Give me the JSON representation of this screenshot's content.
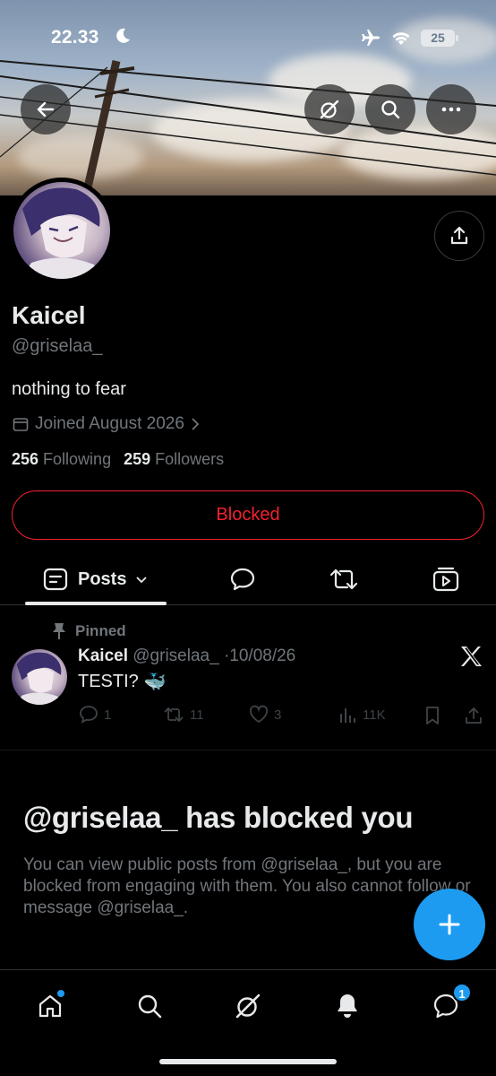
{
  "status_bar": {
    "time": "22.33",
    "battery": "25"
  },
  "profile": {
    "name": "Kaicel",
    "handle": "@griselaa_",
    "bio": "nothing to fear",
    "joined": "Joined August 2026",
    "following_count": "256",
    "following_label": "Following",
    "followers_count": "259",
    "followers_label": "Followers",
    "blocked_button": "Blocked"
  },
  "tabs": {
    "posts_label": "Posts"
  },
  "post": {
    "pinned_label": "Pinned",
    "author": "Kaicel",
    "handle": "@griselaa_",
    "separator": "·",
    "date": "10/08/26",
    "text": "TESTI?",
    "emoji": "🐳",
    "replies": "1",
    "reposts": "11",
    "likes": "3",
    "views": "11K"
  },
  "blocked_notice": {
    "title": "@griselaa_ has blocked you",
    "description": "You can view public posts from @griselaa_, but you are blocked from engaging with them. You also cannot follow or message @griselaa_."
  },
  "bottom_nav": {
    "messages_badge": "1"
  },
  "colors": {
    "accent": "#1d9bf0",
    "blocked": "#f4212e",
    "muted": "#71767b",
    "text": "#e7e9ea"
  }
}
